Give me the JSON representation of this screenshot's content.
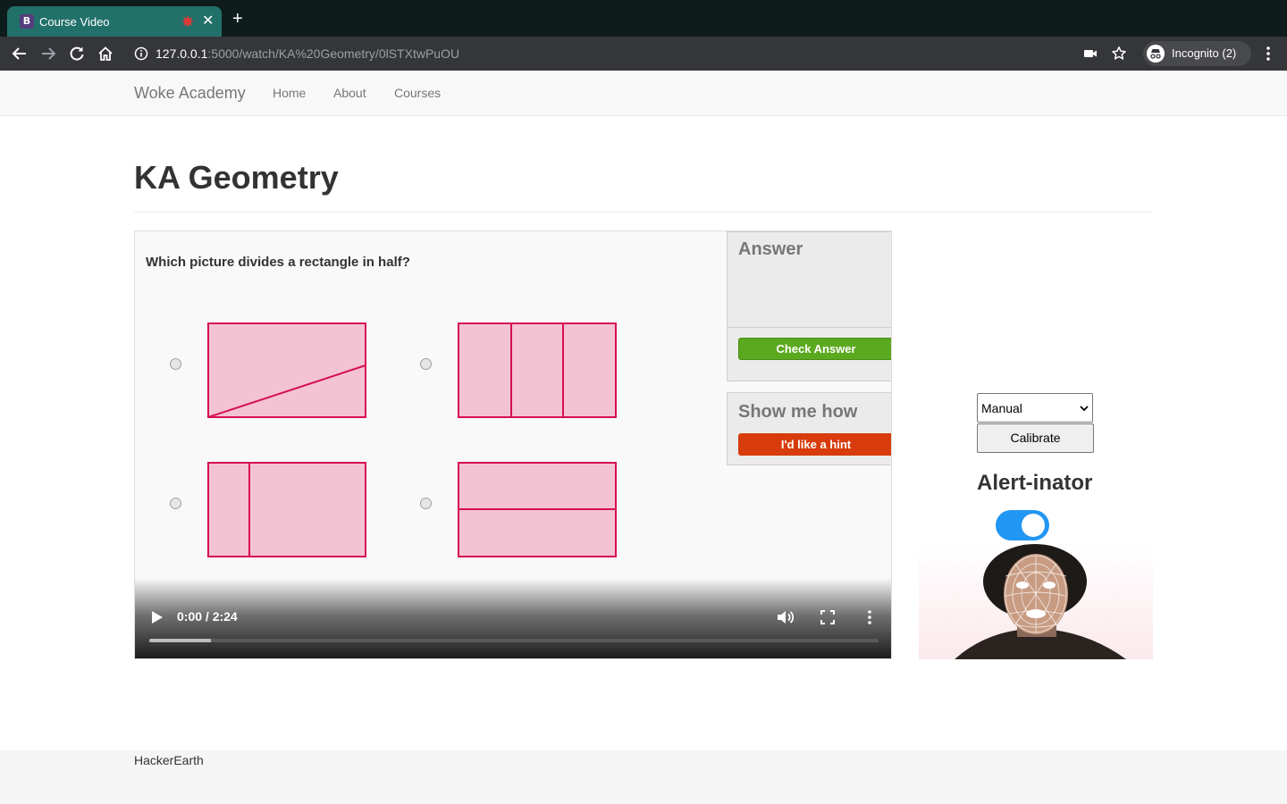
{
  "browser": {
    "tab_title": "Course Video",
    "tab_favicon": "B",
    "url_host": "127.0.0.1",
    "url_path": ":5000/watch/KA%20Geometry/0lSTXtwPuOU",
    "incognito_label": "Incognito (2)"
  },
  "site": {
    "brand": "Woke Academy",
    "nav": [
      "Home",
      "About",
      "Courses"
    ]
  },
  "page": {
    "title": "KA Geometry"
  },
  "video": {
    "question": "Which picture divides a rectangle in half?",
    "answer_title": "Answer",
    "check_label": "Check Answer",
    "hint_title": "Show me how",
    "hint_label": "I'd like a hint",
    "time": "0:00 / 2:24",
    "progress_fraction": 0.085,
    "shape_fill": "#f3c3d4",
    "shape_stroke": "#d6114f"
  },
  "sidebar": {
    "mode_value": "Manual",
    "calibrate_label": "Calibrate",
    "alert_title": "Alert-inator",
    "alert_enabled": true
  },
  "footer": {
    "text": "HackerEarth"
  }
}
